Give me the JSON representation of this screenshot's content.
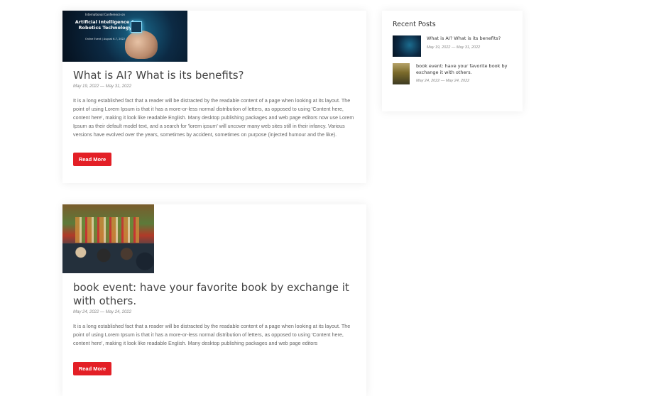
{
  "posts": [
    {
      "image_alt": "AI and Robotics Technology event banner",
      "banner_small": "International Conference on",
      "banner_big": "Artificial Intelligence & Robotics Technology",
      "banner_tiny": "Online Event | August 6-7, 2022",
      "title": "What is AI? What is its benefits?",
      "date": "May 19, 2022 — May 31, 2022",
      "excerpt": "It is a long established fact that a reader will be distracted by the readable content of a page when looking at its layout. The point of using Lorem Ipsum is that it has a more-or-less normal distribution of letters, as opposed to using 'Content here, content here', making it look like readable English. Many desktop publishing packages and web page editors now use Lorem Ipsum as their default model text, and a search for 'lorem ipsum' will uncover many web sites still in their infancy. Various versions have evolved over the years, sometimes by accident, sometimes on purpose (injected humour and the like).",
      "read_more": "Read More"
    },
    {
      "image_alt": "Book event crowd in a bookstore",
      "title": "book event: have your favorite book by exchange it with others.",
      "date": "May 24, 2022 — May 24, 2022",
      "excerpt": "It is a long established fact that a reader will be distracted by the readable content of a page when looking at its layout. The point of using Lorem Ipsum is that it has a more-or-less normal distribution of letters, as opposed to using 'Content here, content here', making it look like readable English. Many desktop publishing packages and web page editors",
      "read_more": "Read More"
    }
  ],
  "sidebar": {
    "widget_title": "Recent Posts",
    "recent": [
      {
        "title": "What is AI? What is its benefits?",
        "date": "May 19, 2022 — May 31, 2022"
      },
      {
        "title": "book event: have your favorite book by exchange it with others.",
        "date": "May 24, 2022 — May 24, 2022"
      }
    ]
  },
  "colors": {
    "accent": "#e31f26",
    "text": "#444444",
    "muted": "#888888"
  }
}
